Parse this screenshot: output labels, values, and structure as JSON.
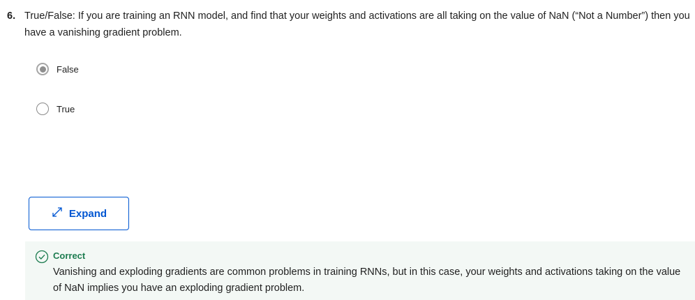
{
  "question": {
    "number": "6.",
    "text": "True/False: If you are training an RNN model, and find that your weights and activations are all taking on the value of NaN (“Not a Number”) then you have a vanishing gradient problem."
  },
  "options": [
    {
      "label": "False",
      "selected": true
    },
    {
      "label": "True",
      "selected": false
    }
  ],
  "expand_button": {
    "label": "Expand",
    "icon": "expand-arrows-icon"
  },
  "feedback": {
    "status": "Correct",
    "icon": "check-circle-icon",
    "text": "Vanishing and exploding gradients are common problems in training RNNs, but in this case, your weights and activations taking on the value of NaN implies you have an exploding gradient problem."
  },
  "colors": {
    "accent_blue": "#0056d2",
    "correct_green": "#1d7c50",
    "feedback_bg": "#f3f8f5"
  }
}
